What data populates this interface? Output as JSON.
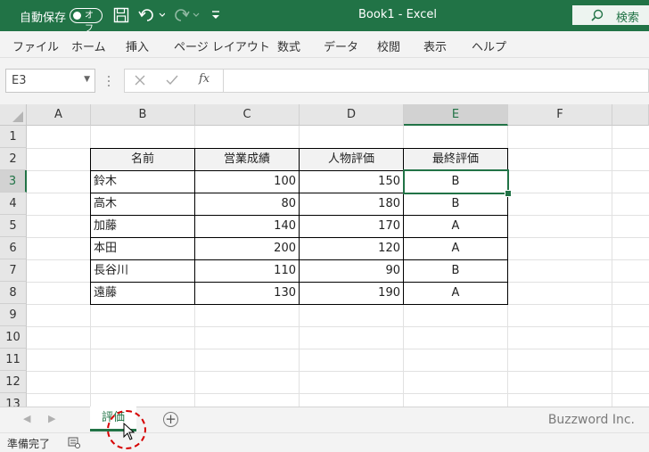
{
  "title_bar": {
    "autosave_label": "自動保存",
    "autosave_state": "オフ",
    "document_title": "Book1  -  Excel",
    "search_label": "検索",
    "bg_color": "#217346"
  },
  "ribbon": {
    "tabs": [
      "ファイル",
      "ホーム",
      "挿入",
      "ページ レイアウト",
      "数式",
      "データ",
      "校閲",
      "表示",
      "ヘルプ"
    ]
  },
  "formula_bar": {
    "name_box": "E3",
    "fx_label": "fx",
    "formula": ""
  },
  "grid": {
    "columns": [
      "A",
      "B",
      "C",
      "D",
      "E",
      "F"
    ],
    "rows": [
      "1",
      "2",
      "3",
      "4",
      "5",
      "6",
      "7",
      "8",
      "9",
      "10",
      "11",
      "12",
      "13"
    ],
    "selected_cell": "E3",
    "accent_color": "#217346"
  },
  "table": {
    "headers": [
      "名前",
      "営業成績",
      "人物評価",
      "最終評価"
    ],
    "rows": [
      [
        "鈴木",
        "100",
        "150",
        "B"
      ],
      [
        "高木",
        "80",
        "180",
        "B"
      ],
      [
        "加藤",
        "140",
        "170",
        "A"
      ],
      [
        "本田",
        "200",
        "120",
        "A"
      ],
      [
        "長谷川",
        "110",
        "90",
        "B"
      ],
      [
        "遠藤",
        "130",
        "190",
        "A"
      ]
    ]
  },
  "sheet_tabs": {
    "tabs": [
      "評価"
    ],
    "active": "評価",
    "add_label": "+",
    "watermark": "Buzzword Inc."
  },
  "status_bar": {
    "status": "準備完了"
  }
}
